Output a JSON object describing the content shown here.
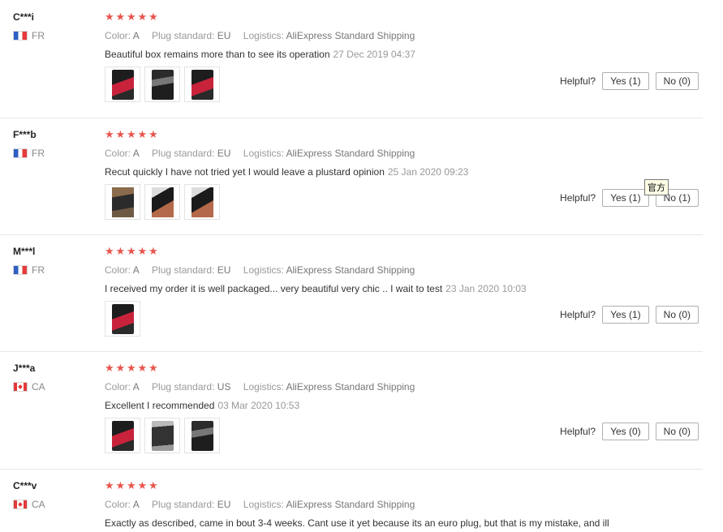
{
  "labels": {
    "color": "Color:",
    "plug": "Plug standard:",
    "logistics": "Logistics:",
    "helpful": "Helpful?"
  },
  "reviews": [
    {
      "user": "C***i",
      "country": "FR",
      "flag": "fr",
      "rating": 5,
      "color": "A",
      "plug": "EU",
      "logistics": "AliExpress Standard Shipping",
      "text": "Beautiful box remains more than to see its operation",
      "date": "27 Dec 2019 04:37",
      "yes": "Yes (1)",
      "no": "No (0)"
    },
    {
      "user": "F***b",
      "country": "FR",
      "flag": "fr",
      "rating": 4.5,
      "color": "A",
      "plug": "EU",
      "logistics": "AliExpress Standard Shipping",
      "text": "Recut quickly I have not tried yet I would leave a plustard opinion",
      "date": "25 Jan 2020 09:23",
      "yes": "Yes (1)",
      "no": "No (1)"
    },
    {
      "user": "M***l",
      "country": "FR",
      "flag": "fr",
      "rating": 5,
      "color": "A",
      "plug": "EU",
      "logistics": "AliExpress Standard Shipping",
      "text": "I received my order it is well packaged... very beautiful very chic .. I wait to test",
      "date": "23 Jan 2020 10:03",
      "yes": "Yes (1)",
      "no": "No (0)"
    },
    {
      "user": "J***a",
      "country": "CA",
      "flag": "ca",
      "rating": 5,
      "color": "A",
      "plug": "US",
      "logistics": "AliExpress Standard Shipping",
      "text": "Excellent I recommended",
      "date": "03 Mar 2020 10:53",
      "yes": "Yes (0)",
      "no": "No (0)"
    },
    {
      "user": "C***v",
      "country": "CA",
      "flag": "ca",
      "rating": 4.5,
      "color": "A",
      "plug": "EU",
      "logistics": "AliExpress Standard Shipping",
      "text": "Exactly as described, came in bout 3-4 weeks. Cant use it yet because its an euro plug, but that is my mistake, and ill"
    }
  ],
  "tooltip": "官方",
  "icons": {
    "star": "star-icon",
    "half_star": "half-star-icon",
    "flag": "flag-icon"
  },
  "colors": {
    "star": "#e8554d",
    "muted": "#999999",
    "border": "#b0b0b0"
  }
}
